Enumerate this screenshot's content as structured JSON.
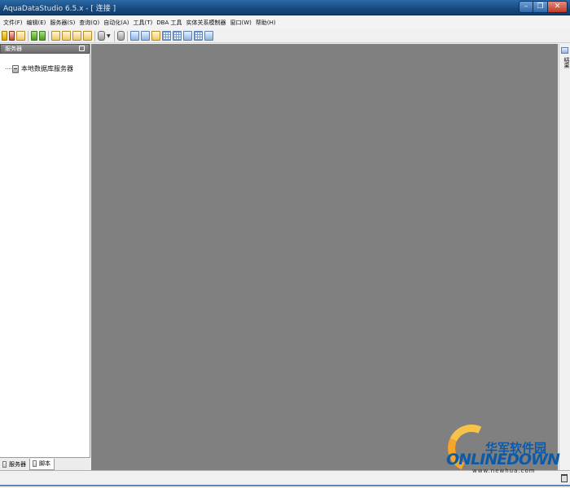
{
  "window": {
    "title": "AquaDataStudio 6.5.x - [ 连接 ]",
    "minimize_glyph": "–",
    "maximize_glyph": "❐",
    "close_glyph": "✕"
  },
  "menu": {
    "items": [
      {
        "label": "文件(F)"
      },
      {
        "label": "编辑(E)"
      },
      {
        "label": "服务器(S)"
      },
      {
        "label": "查询(Q)"
      },
      {
        "label": "自动化(A)"
      },
      {
        "label": "工具(T)"
      },
      {
        "label": "DBA 工具"
      },
      {
        "label": "实体关系模制器"
      },
      {
        "label": "窗口(W)"
      },
      {
        "label": "帮助(H)"
      }
    ]
  },
  "toolbar": {
    "icons": [
      "key-icon",
      "key-red-icon",
      "doc-icon",
      "key-green-icon",
      "key-green-icon",
      "doc-icon",
      "doc-icon",
      "doc-icon",
      "doc-icon",
      "database-icon",
      "print-icon",
      "grid-icon",
      "table-icon",
      "doc-icon",
      "grid-icon",
      "grid-icon",
      "grid-icon",
      "grid-icon",
      "grid-icon"
    ],
    "dropdown_glyph": "▼"
  },
  "left_panel": {
    "header": "服务器",
    "tree": [
      {
        "label": "本地数据库服务器",
        "icon": "server-icon"
      }
    ],
    "tabs": [
      {
        "label": "服务器",
        "active": false
      },
      {
        "label": "脚本",
        "active": true
      }
    ]
  },
  "right_dock": {
    "label": "结果"
  },
  "watermark": {
    "cn": "华军软件园",
    "en": "ONLINEDOWN",
    "url": "www.newhua.com",
    "colors": {
      "blue": "#0d5aa7",
      "orange": "#f7a52a"
    }
  },
  "colors": {
    "titlebar": "#18497e",
    "workspace": "#808080",
    "panel_header": "#7a7a7a"
  }
}
